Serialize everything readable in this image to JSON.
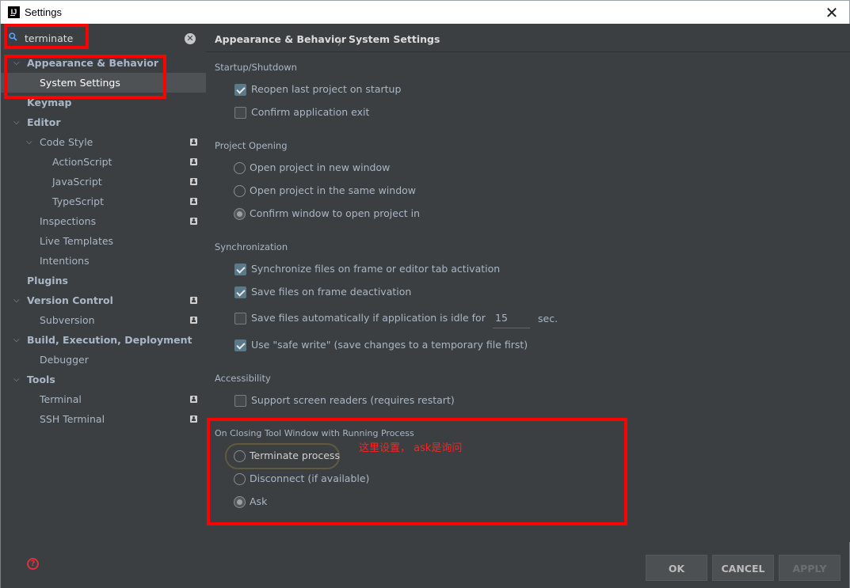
{
  "window": {
    "title": "Settings",
    "app_icon_letters": "IJ",
    "close_glyph": "✕"
  },
  "search": {
    "value": "terminate",
    "placeholder": ""
  },
  "sidebar": {
    "items": [
      {
        "label": "Appearance & Behavior",
        "level": 0,
        "expanded": true,
        "bold": true
      },
      {
        "label": "System Settings",
        "level": 1,
        "selected": true
      },
      {
        "label": "Keymap",
        "level": 0,
        "bold": true
      },
      {
        "label": "Editor",
        "level": 0,
        "expanded": true,
        "bold": true
      },
      {
        "label": "Code Style",
        "level": 1,
        "expanded": true,
        "project_icon": true
      },
      {
        "label": "ActionScript",
        "level": 2,
        "project_icon": true
      },
      {
        "label": "JavaScript",
        "level": 2,
        "project_icon": true
      },
      {
        "label": "TypeScript",
        "level": 2,
        "project_icon": true
      },
      {
        "label": "Inspections",
        "level": 1,
        "project_icon": true
      },
      {
        "label": "Live Templates",
        "level": 1
      },
      {
        "label": "Intentions",
        "level": 1
      },
      {
        "label": "Plugins",
        "level": 0,
        "bold": true
      },
      {
        "label": "Version Control",
        "level": 0,
        "expanded": true,
        "bold": true,
        "project_icon": true
      },
      {
        "label": "Subversion",
        "level": 1,
        "project_icon": true
      },
      {
        "label": "Build, Execution, Deployment",
        "level": 0,
        "expanded": true,
        "bold": true
      },
      {
        "label": "Debugger",
        "level": 1
      },
      {
        "label": "Tools",
        "level": 0,
        "expanded": true,
        "bold": true
      },
      {
        "label": "Terminal",
        "level": 1,
        "project_icon": true
      },
      {
        "label": "SSH Terminal",
        "level": 1,
        "project_icon": true
      }
    ]
  },
  "breadcrumb": {
    "parent": "Appearance & Behavior",
    "separator": "〉",
    "current": "System Settings"
  },
  "startup": {
    "heading": "Startup/Shutdown",
    "reopen_last": {
      "label": "Reopen last project on startup",
      "checked": true
    },
    "confirm_exit": {
      "label": "Confirm application exit",
      "checked": false
    }
  },
  "project_opening": {
    "heading": "Project Opening",
    "options": [
      {
        "label": "Open project in new window",
        "selected": false
      },
      {
        "label": "Open project in the same window",
        "selected": false
      },
      {
        "label": "Confirm window to open project in",
        "selected": true
      }
    ]
  },
  "synchronization": {
    "heading": "Synchronization",
    "sync_on_activation": {
      "label": "Synchronize files on frame or editor tab activation",
      "checked": true
    },
    "save_on_deactivation": {
      "label": "Save files on frame deactivation",
      "checked": true
    },
    "save_idle": {
      "label": "Save files automatically if application is idle for",
      "checked": false,
      "value": "15",
      "unit": "sec."
    },
    "safe_write": {
      "label": "Use \"safe write\" (save changes to a temporary file first)",
      "checked": true
    }
  },
  "accessibility": {
    "heading": "Accessibility",
    "screen_readers": {
      "label": "Support screen readers (requires restart)",
      "checked": false
    }
  },
  "closing_tool_window": {
    "heading": "On Closing Tool Window with Running Process",
    "options": [
      {
        "label": "Terminate process",
        "selected": false,
        "focused": true
      },
      {
        "label": "Disconnect (if available)",
        "selected": false
      },
      {
        "label": "Ask",
        "selected": true
      }
    ]
  },
  "annotation": {
    "text": "这里设置，  ask是询问",
    "color": "#ff0000"
  },
  "footer": {
    "help_glyph": "?",
    "ok_label": "OK",
    "cancel_label": "CANCEL",
    "apply_label": "APPLY",
    "apply_enabled": false
  },
  "colors": {
    "panel_bg": "#3c3f41",
    "text": "#a9b7c6",
    "selection": "#0d293e",
    "highlight_red": "#ff0000"
  }
}
